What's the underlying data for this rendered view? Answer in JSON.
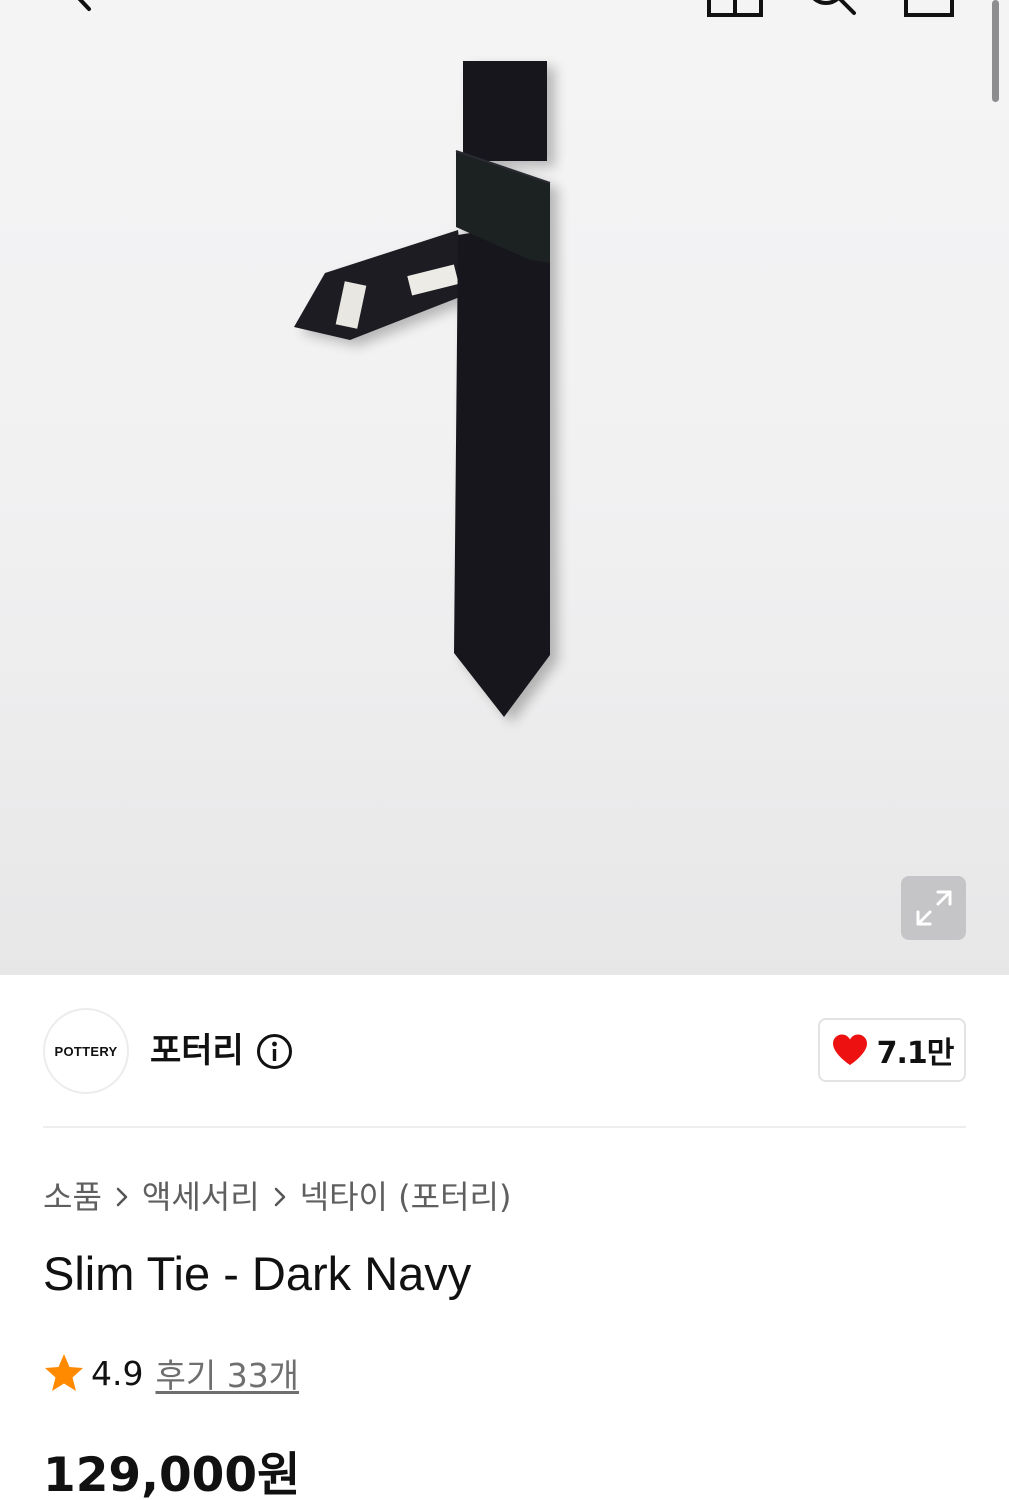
{
  "topbar": {
    "icons": [
      "back-icon",
      "shop-icon",
      "search-icon",
      "cart-icon"
    ]
  },
  "product_image": {
    "icon": "expand-icon"
  },
  "brand": {
    "logo_text": "POTTERY",
    "name": "포터리",
    "info_icon": "info-icon"
  },
  "likes": {
    "count": "7.1만",
    "icon": "heart-icon",
    "color": "#ee1111"
  },
  "breadcrumb": {
    "items": [
      "소품",
      "액세서리",
      "넥타이 (포터리)"
    ]
  },
  "product": {
    "title": "Slim Tie - Dark Navy",
    "rating": "4.9",
    "review_link": "후기 33개",
    "star_color": "#ff8a00",
    "price": "129,000원"
  }
}
